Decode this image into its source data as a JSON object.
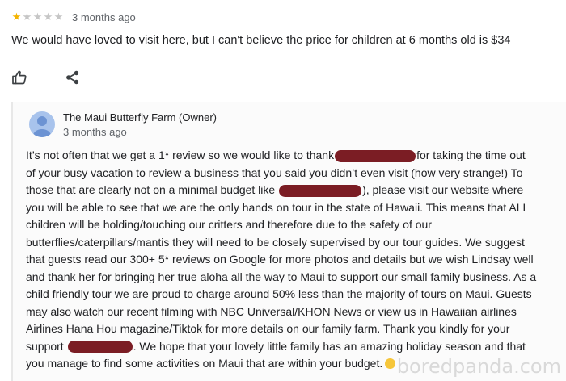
{
  "review": {
    "rating": 1,
    "max_rating": 5,
    "date": "3 months ago",
    "text": "We would have loved to visit here, but I can't believe the price for children at 6 months old is $34"
  },
  "actions": {
    "like_icon": "thumbs-up-icon",
    "share_icon": "share-icon"
  },
  "owner_reply": {
    "name": "The Maui Butterfly Farm (Owner)",
    "date": "3 months ago",
    "line_1a": "It’s not often that we get a 1* review so we would like to thank",
    "line_1b": "for taking the time out",
    "line_2": "of your busy vacation to review a business that you said you didn’t even visit (how very strange!) To",
    "line_3a": "those that are clearly not on a minimal budget like",
    "line_3b": "), please visit our website where",
    "line_4": "you will be able to see that we are the only hands on tour in the state of Hawaii. This means that ALL",
    "line_5": "children will be holding/touching our critters and therefore due to the safety of our",
    "line_6": "butterflies/caterpillars/mantis they will need to be closely supervised by our tour guides. We suggest",
    "line_7": "that guests read our 300+ 5* reviews on Google for more photos and details but we wish Lindsay well",
    "line_8": "and thank her for bringing her true aloha all the way to Maui to support our small family business. As a",
    "line_9": "child friendly tour we are proud to charge around 50% less than the majority of tours on Maui. Guests",
    "line_10": "may also watch our recent filming with NBC Universal/KHON News or view us in Hawaiian airlines",
    "line_11": "Airlines Hana Hou magazine/Tiktok for more details on our family farm. Thank you kindly for your",
    "line_12a": "support",
    "line_12b": ". We hope that your lovely little family has an amazing holiday season and that",
    "line_13": "you manage to find some activities on Maui that are within your budget."
  },
  "watermark": "boredpanda.com",
  "colors": {
    "star_filled": "#f4b400",
    "redaction": "#7b1d24",
    "avatar": "#a8c3ec"
  }
}
